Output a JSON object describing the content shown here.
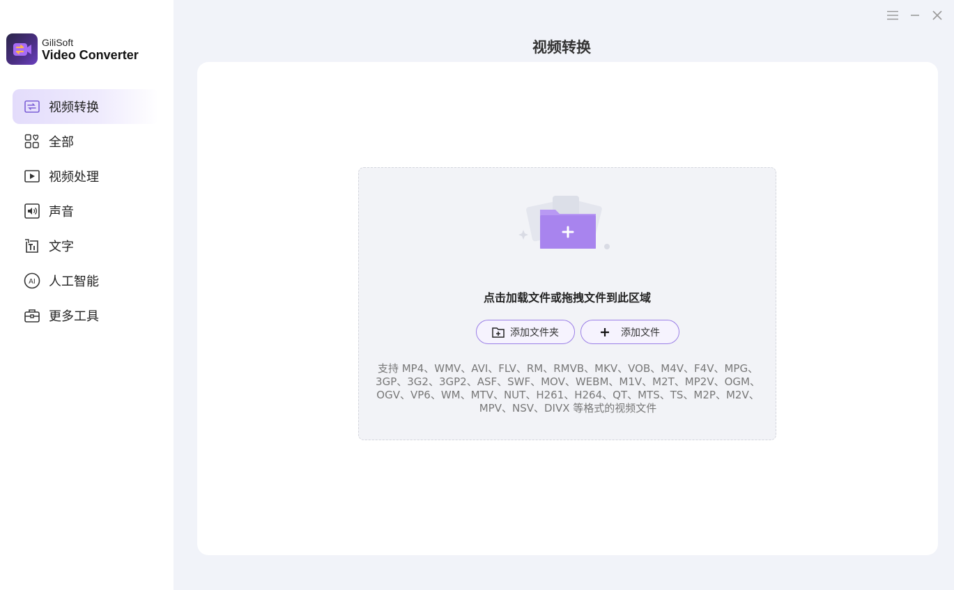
{
  "brand": {
    "name": "GiliSoft",
    "product": "Video Converter"
  },
  "window_controls": {
    "menu_icon": "menu-icon",
    "minimize_icon": "minimize-icon",
    "close_icon": "close-icon"
  },
  "nav": [
    {
      "label": "视频转换",
      "icon": "video-convert-icon",
      "active": true
    },
    {
      "label": "全部",
      "icon": "grid-icon",
      "active": false
    },
    {
      "label": "视频处理",
      "icon": "play-icon",
      "active": false
    },
    {
      "label": "声音",
      "icon": "audio-icon",
      "active": false
    },
    {
      "label": "文字",
      "icon": "text-icon",
      "active": false
    },
    {
      "label": "人工智能",
      "icon": "ai-icon",
      "active": false
    },
    {
      "label": "更多工具",
      "icon": "toolbox-icon",
      "active": false
    }
  ],
  "main": {
    "title": "视频转换",
    "drop_hint": "点击加载文件或拖拽文件到此区域",
    "add_folder_label": "添加文件夹",
    "add_file_label": "添加文件",
    "formats_text": "支持 MP4、WMV、AVI、FLV、RM、RMVB、MKV、VOB、M4V、F4V、MPG、3GP、3G2、3GP2、ASF、SWF、MOV、WEBM、M1V、M2T、MP2V、OGM、OGV、VP6、WM、MTV、NUT、H261、H264、QT、MTS、TS、M2P、M2V、MPV、NSV、DIVX 等格式的视频文件"
  },
  "colors": {
    "accent": "#9a7ee6",
    "active_nav": "#e3dcfb",
    "background": "#f1f3f9"
  }
}
